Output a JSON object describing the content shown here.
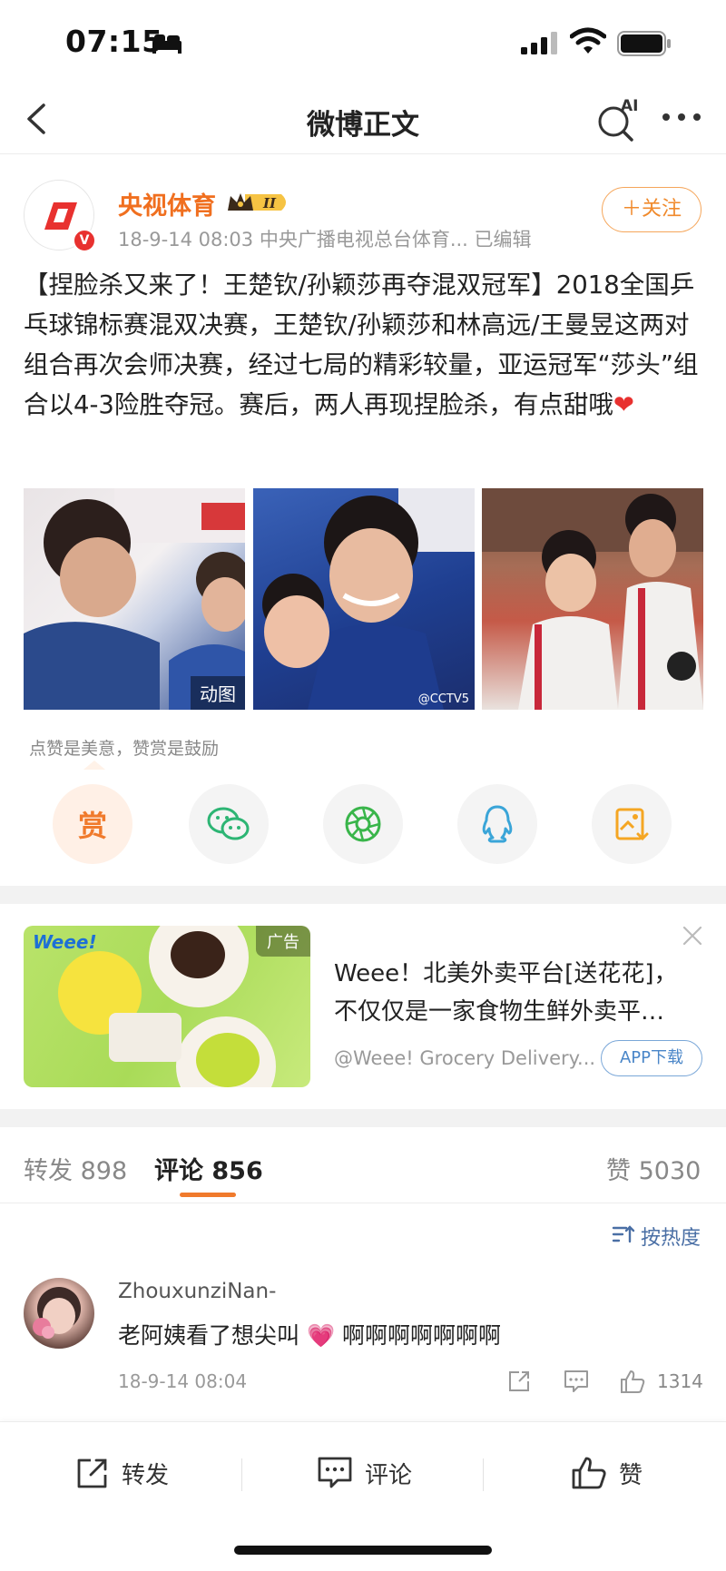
{
  "status_bar": {
    "time": "07:15"
  },
  "nav": {
    "title": "微博正文",
    "ai_label": "AI"
  },
  "post": {
    "author": "央视体育",
    "verified_badge": "V",
    "level_badge": "II",
    "meta": "18-9-14 08:03  中央广播电视总台体育...  已编辑",
    "follow_label": "＋关注",
    "text": "【捏脸杀又来了！王楚钦/孙颖莎再夺混双冠军】2018全国乒乓球锦标赛混双决赛，王楚钦/孙颖莎和林高远/王曼昱这两对组合再次会师决赛，经过七局的精彩较量，亚运冠军“莎头”组合以4-3险胜夺冠。赛后，两人再现捏脸杀，有点甜哦",
    "heart": "❤",
    "images": [
      {
        "badge": "动图"
      },
      {
        "watermark": "@CCTV5"
      },
      {
        "badge": ""
      }
    ],
    "reward_hint": "点赞是美意，赞赏是鼓励",
    "reward_label": "赏"
  },
  "share_icons": [
    "reward-icon",
    "wechat-icon",
    "moments-icon",
    "qq-icon",
    "save-image-icon"
  ],
  "ad": {
    "brand": "Weee!",
    "tag": "广告",
    "title": "Weee！北美外卖平台[送花花]，不仅仅是一家食物生鲜外卖平…",
    "source": "@Weee! Grocery Delivery...",
    "button": "APP下载"
  },
  "tabs": {
    "repost": "转发 898",
    "comment": "评论 856",
    "like": "赞 5030"
  },
  "sort_label": "按热度",
  "comment": {
    "user": "ZhouxunziNan-",
    "text": "老阿姨看了想尖叫 💗 啊啊啊啊啊啊啊",
    "time": "18-9-14 08:04",
    "likes": "1314"
  },
  "bottom_bar": {
    "repost": "转发",
    "comment": "评论",
    "like": "赞"
  },
  "colors": {
    "accent": "#f07a2c",
    "author": "#f06f1f",
    "verified": "#e8312f",
    "link": "#4a6fa5"
  }
}
